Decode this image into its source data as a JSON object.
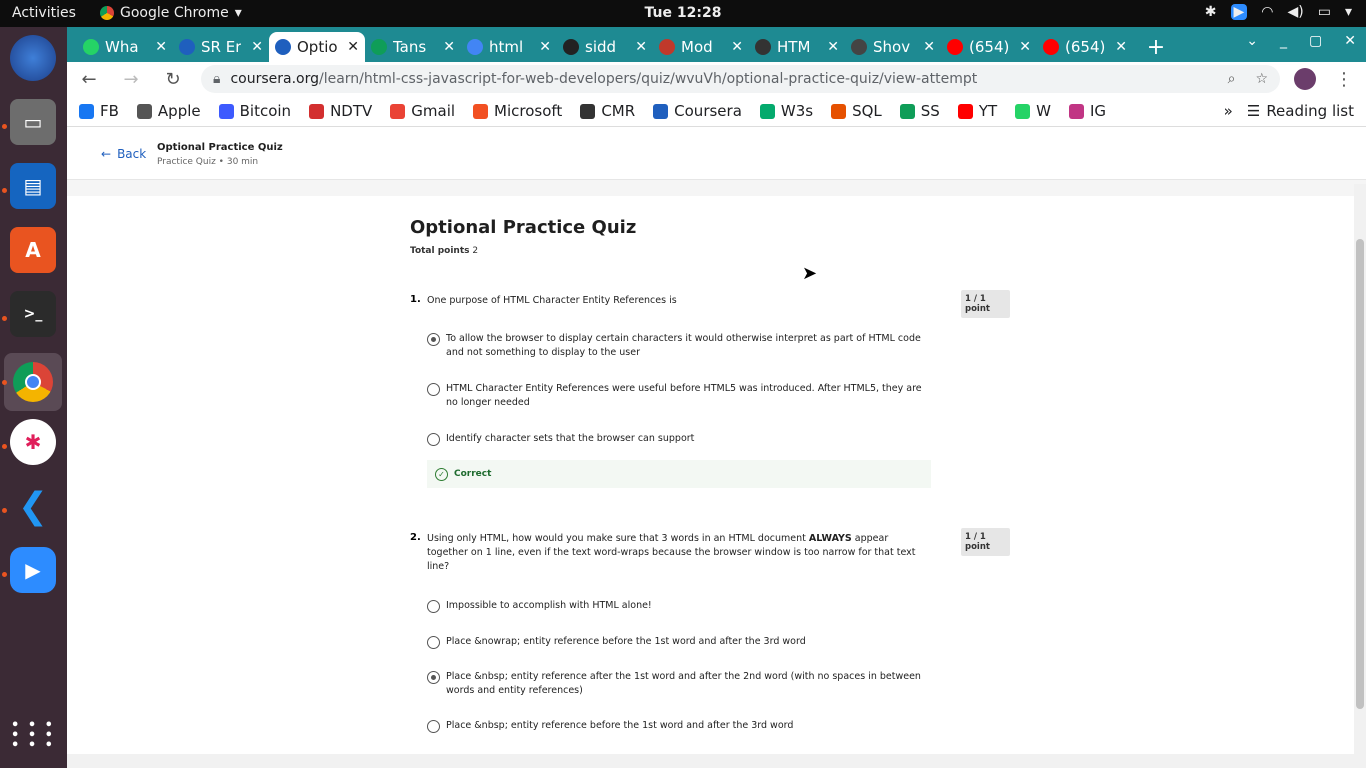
{
  "system": {
    "activities": "Activities",
    "app_name": "Google Chrome",
    "clock": "Tue 12:28"
  },
  "tabs": [
    {
      "title": "Wha",
      "color": "#25d366",
      "icon": "whatsapp-icon"
    },
    {
      "title": "SR Er",
      "color": "#1f5fbe",
      "icon": "coursera-icon"
    },
    {
      "title": "Optio",
      "color": "#1f5fbe",
      "icon": "coursera-icon",
      "active": true
    },
    {
      "title": "Tans",
      "color": "#0f9d58",
      "icon": "sheets-icon"
    },
    {
      "title": "html",
      "color": "#4285f4",
      "icon": "google-icon"
    },
    {
      "title": "sidd",
      "color": "#222222",
      "icon": "github-icon"
    },
    {
      "title": "Mod",
      "color": "#c0392b",
      "icon": "mdn-icon"
    },
    {
      "title": "HTM",
      "color": "#333333",
      "icon": "globe-icon"
    },
    {
      "title": "Shov",
      "color": "#444444",
      "icon": "site-icon"
    },
    {
      "title": "(654)",
      "color": "#ff0000",
      "icon": "youtube-icon"
    },
    {
      "title": "(654)",
      "color": "#ff0000",
      "icon": "youtube-icon"
    }
  ],
  "address": {
    "host": "coursera.org",
    "path": "/learn/html-css-javascript-for-web-developers/quiz/wvuVh/optional-practice-quiz/view-attempt"
  },
  "bookmarks": [
    {
      "label": "FB",
      "color": "#1877f2"
    },
    {
      "label": "Apple",
      "color": "#555555"
    },
    {
      "label": "Bitcoin",
      "color": "#3d5afe"
    },
    {
      "label": "NDTV",
      "color": "#d32f2f"
    },
    {
      "label": "Gmail",
      "color": "#ea4335"
    },
    {
      "label": "Microsoft",
      "color": "#f25022"
    },
    {
      "label": "CMR",
      "color": "#333333"
    },
    {
      "label": "Coursera",
      "color": "#1f5fbe"
    },
    {
      "label": "W3s",
      "color": "#04aa6d"
    },
    {
      "label": "SQL",
      "color": "#e65100"
    },
    {
      "label": "SS",
      "color": "#0f9d58"
    },
    {
      "label": "YT",
      "color": "#ff0000"
    },
    {
      "label": "W",
      "color": "#25d366"
    },
    {
      "label": "IG",
      "color": "#c13584"
    }
  ],
  "reading_list": "Reading list",
  "header": {
    "back": "Back",
    "title": "Optional Practice Quiz",
    "subtitle": "Practice Quiz • 30 min"
  },
  "quiz": {
    "title": "Optional Practice Quiz",
    "total_points_label": "Total points",
    "total_points_value": "2",
    "questions": [
      {
        "number": "1.",
        "text": "One purpose of HTML Character Entity References is",
        "points": "1 / 1 point",
        "options": [
          {
            "text": "To allow the browser to display certain characters it would otherwise interpret as part of HTML code and not something to display to the user",
            "selected": true
          },
          {
            "text": "HTML Character Entity References were useful before HTML5 was introduced. After HTML5, they are no longer needed",
            "selected": false
          },
          {
            "text": "Identify character sets that the browser can support",
            "selected": false
          }
        ],
        "feedback": "Correct"
      },
      {
        "number": "2.",
        "text_before": "Using only HTML, how would you make sure that 3 words in an HTML document ",
        "text_bold": "ALWAYS",
        "text_after": " appear together on 1 line, even if the text word-wraps because the browser window is too narrow for that text line?",
        "points": "1 / 1 point",
        "options": [
          {
            "text": "Impossible to accomplish with HTML alone!",
            "selected": false
          },
          {
            "text": "Place &nowrap; entity reference before the 1st word and after the 3rd word",
            "selected": false
          },
          {
            "text": "Place &nbsp; entity reference after the 1st word and after the 2nd word (with no spaces in between words and entity references)",
            "selected": true
          },
          {
            "text": "Place &nbsp; entity reference before the 1st word and after the 3rd word",
            "selected": false
          }
        ]
      }
    ]
  }
}
